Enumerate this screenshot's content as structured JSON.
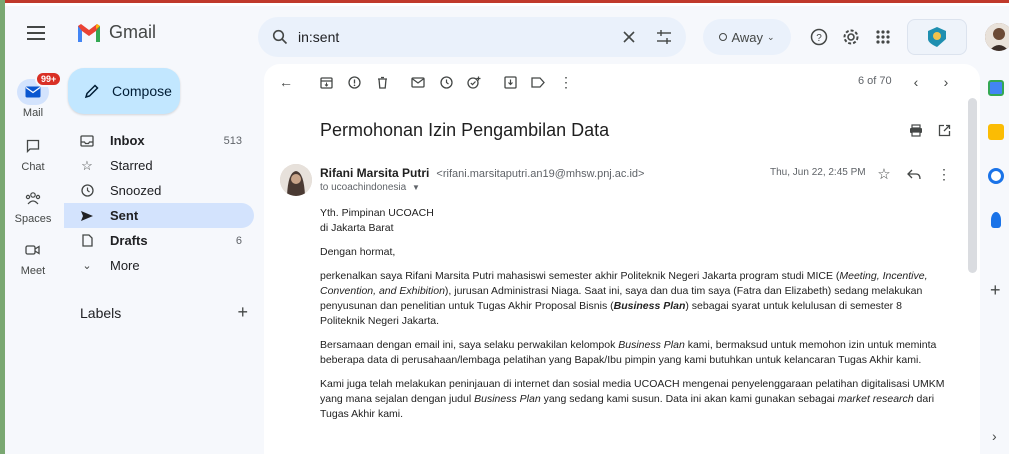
{
  "app": {
    "name": "Gmail"
  },
  "search": {
    "query": "in:sent"
  },
  "status": {
    "label": "Away"
  },
  "rail": [
    {
      "label": "Mail",
      "badge": "99+"
    },
    {
      "label": "Chat"
    },
    {
      "label": "Spaces"
    },
    {
      "label": "Meet"
    }
  ],
  "compose": {
    "label": "Compose"
  },
  "nav": [
    {
      "label": "Inbox",
      "count": "513",
      "icon": "inbox-icon"
    },
    {
      "label": "Starred",
      "count": "",
      "icon": "star-icon"
    },
    {
      "label": "Snoozed",
      "count": "",
      "icon": "clock-icon"
    },
    {
      "label": "Sent",
      "count": "",
      "icon": "send-icon",
      "active": true
    },
    {
      "label": "Drafts",
      "count": "6",
      "icon": "draft-icon"
    },
    {
      "label": "More",
      "count": "",
      "icon": "chevron-down-icon"
    }
  ],
  "labels": {
    "title": "Labels"
  },
  "pager": {
    "text": "6 of 70"
  },
  "email": {
    "subject": "Permohonan Izin Pengambilan Data",
    "sender_name": "Rifani Marsita Putri",
    "sender_email": "<rifani.marsitaputri.an19@mhsw.pnj.ac.id>",
    "to": "to ucoachindonesia",
    "date": "Thu, Jun 22, 2:45 PM",
    "greeting_1": "Yth. Pimpinan UCOACH",
    "greeting_2": "di Jakarta Barat",
    "salutation": "Dengan hormat,",
    "p1_a": "perkenalkan saya Rifani Marsita Putri mahasiswi semester akhir Politeknik Negeri Jakarta program studi MICE (",
    "p1_b": "Meeting, Incentive, Convention, and Exhibition",
    "p1_c": "), jurusan Administrasi Niaga. Saat ini, saya dan dua tim saya (Fatra dan Elizabeth) sedang melakukan penyusunan dan penelitian untuk Tugas Akhir Proposal Bisnis (",
    "p1_d": "Business Plan",
    "p1_e": ") sebagai syarat untuk kelulusan di semester 8 Politeknik Negeri Jakarta.",
    "p2_a": "Bersamaan dengan email ini, saya selaku perwakilan kelompok ",
    "p2_b": "Business Plan",
    "p2_c": " kami, bermaksud untuk memohon izin untuk meminta beberapa data di perusahaan/lembaga pelatihan yang Bapak/Ibu pimpin yang kami butuhkan untuk kelancaran Tugas Akhir kami.",
    "p3_a": "Kami juga telah melakukan peninjauan di internet dan sosial media UCOACH mengenai penyelenggaraan pelatihan digitalisasi UMKM yang mana sejalan dengan judul ",
    "p3_b": "Business Plan",
    "p3_c": " yang sedang kami susun. Data ini akan kami gunakan sebagai ",
    "p3_d": "market research",
    "p3_e": " dari Tugas Akhir kami."
  },
  "colors": {
    "accent": "#c2e7ff",
    "active_nav": "#d3e3fd",
    "badge": "#d93025"
  }
}
